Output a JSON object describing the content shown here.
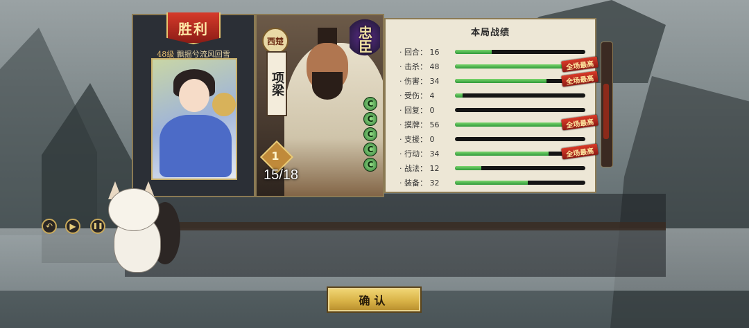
{
  "result": {
    "victory_label": "胜利"
  },
  "player": {
    "level_label": "48级",
    "nickname": "飘摇兮流风回雪"
  },
  "hero": {
    "faction": "西楚",
    "name": "项梁",
    "role": "忠臣",
    "hp": 5,
    "seat_number": "1",
    "cards_count": "15/18"
  },
  "stats": {
    "title": "本局战绩",
    "rows": [
      {
        "label": "· 回合：",
        "value": "16",
        "fraction": 0.28,
        "badge": ""
      },
      {
        "label": "· 击杀：",
        "value": "48",
        "fraction": 0.93,
        "badge": "全场最高"
      },
      {
        "label": "· 伤害：",
        "value": "34",
        "fraction": 0.7,
        "badge": "全场最高"
      },
      {
        "label": "· 受伤：",
        "value": "4",
        "fraction": 0.06,
        "badge": ""
      },
      {
        "label": "· 回复：",
        "value": "0",
        "fraction": 0.0,
        "badge": ""
      },
      {
        "label": "· 摸牌：",
        "value": "56",
        "fraction": 0.92,
        "badge": "全场最高"
      },
      {
        "label": "· 支援：",
        "value": "0",
        "fraction": 0.0,
        "badge": ""
      },
      {
        "label": "· 行动：",
        "value": "34",
        "fraction": 0.72,
        "badge": "全场最高"
      },
      {
        "label": "· 战法：",
        "value": "12",
        "fraction": 0.2,
        "badge": ""
      },
      {
        "label": "· 装备：",
        "value": "32",
        "fraction": 0.56,
        "badge": ""
      }
    ]
  },
  "controls": {
    "back_icon": "↶",
    "play_icon": "▶",
    "pause_icon": "❚❚",
    "replay_progress": 0.03
  },
  "confirm_label": "确认"
}
